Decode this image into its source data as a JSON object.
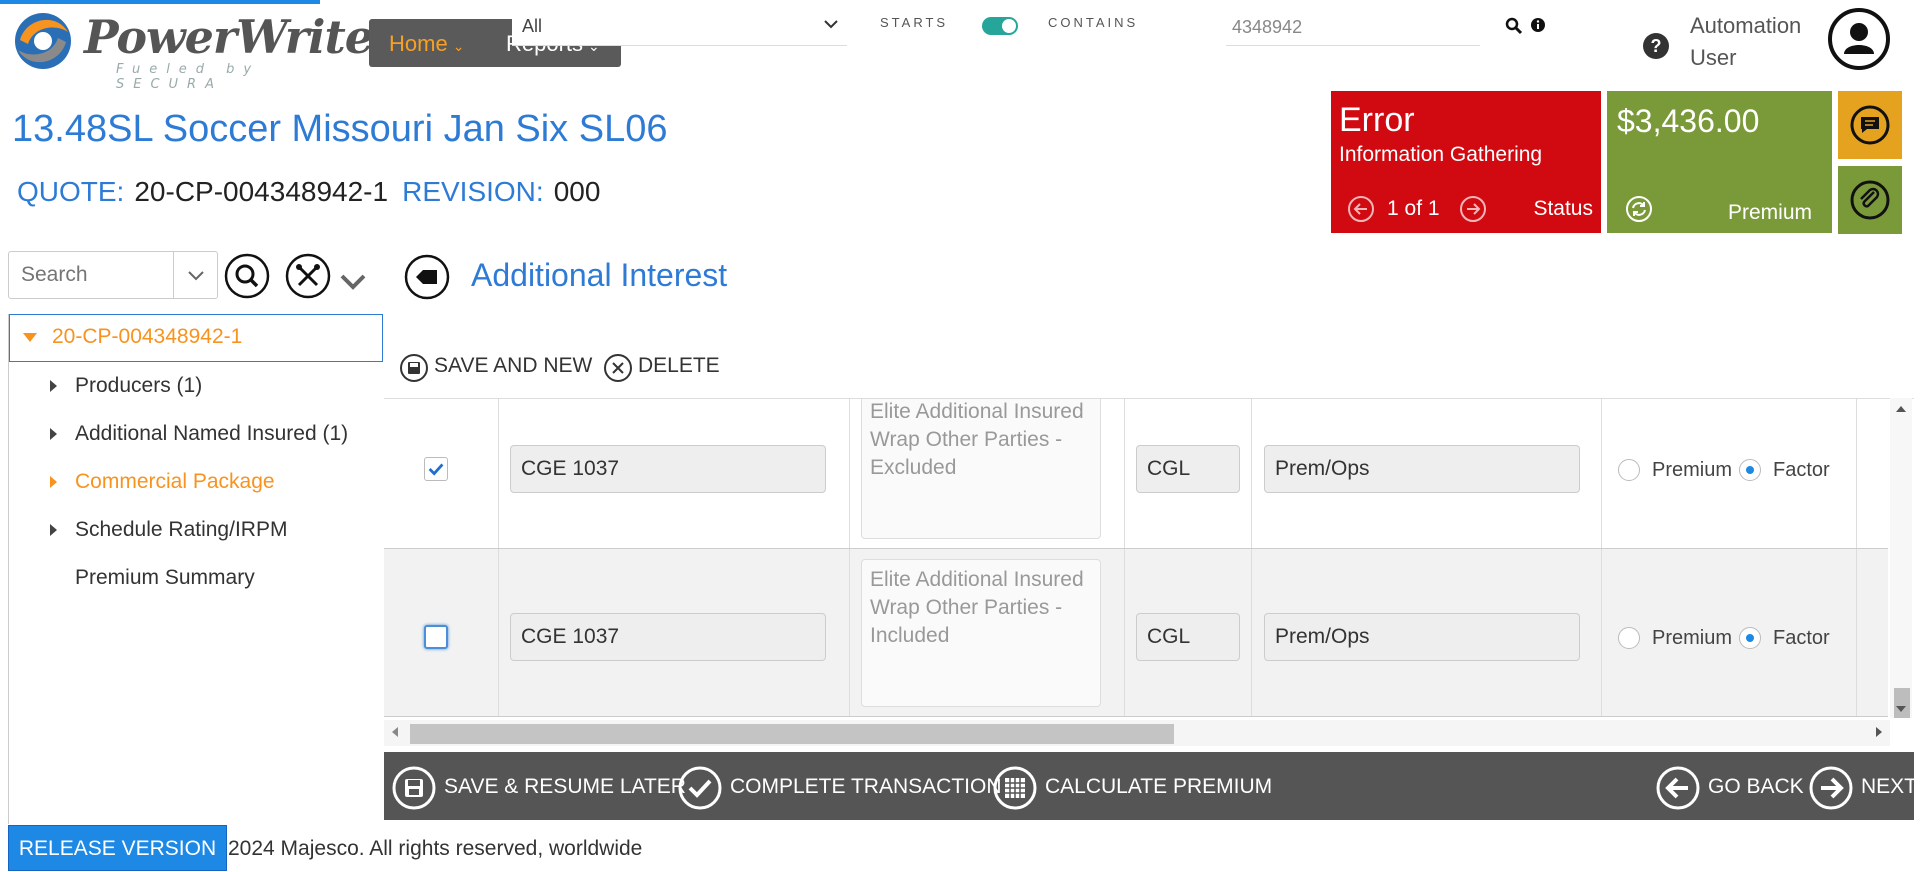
{
  "app": {
    "logo_name": "PowerWriter",
    "logo_tagline": "Fueled by SECURA"
  },
  "nav": {
    "home": "Home",
    "reports": "Reports"
  },
  "search_bar": {
    "scope_value": "All",
    "starts_label": "STARTS",
    "contains_label": "CONTAINS",
    "toggle_on": true,
    "query_value": "4348942"
  },
  "user": {
    "name": "Automation User"
  },
  "header": {
    "title": "13.48SL Soccer Missouri Jan Six SL06",
    "quote_label": "QUOTE:",
    "quote_value": "20-CP-004348942-1",
    "revision_label": "REVISION:",
    "revision_value": "000"
  },
  "status_tile": {
    "state": "Error",
    "detail": "Information Gathering",
    "pager": "1 of 1",
    "label": "Status",
    "color": "#d10a11"
  },
  "premium_tile": {
    "amount": "$3,436.00",
    "label": "Premium",
    "color": "#7a9a3a"
  },
  "sidebar": {
    "search_placeholder": "Search",
    "root": "20-CP-004348942-1",
    "items": [
      {
        "label": "Producers (1)",
        "expandable": true,
        "active": false
      },
      {
        "label": "Additional Named Insured (1)",
        "expandable": true,
        "active": false
      },
      {
        "label": "Commercial Package",
        "expandable": true,
        "active": true
      },
      {
        "label": "Schedule Rating/IRPM",
        "expandable": true,
        "active": false
      },
      {
        "label": "Premium Summary",
        "expandable": false,
        "active": false
      }
    ]
  },
  "section": {
    "title": "Additional Interest",
    "save_and_new": "SAVE AND NEW",
    "delete": "DELETE"
  },
  "grid": {
    "rows": [
      {
        "checked": true,
        "form": "CGE 1037",
        "description": "Elite Additional Insured Wrap Other Parties - Excluded",
        "lob": "CGL",
        "coverage": "Prem/Ops",
        "premium_label": "Premium",
        "factor_label": "Factor",
        "selected": "Factor"
      },
      {
        "checked": false,
        "form": "CGE 1037",
        "description": "Elite Additional Insured Wrap Other Parties - Included",
        "lob": "CGL",
        "coverage": "Prem/Ops",
        "premium_label": "Premium",
        "factor_label": "Factor",
        "selected": "Factor"
      }
    ]
  },
  "action_bar": {
    "save_resume": "SAVE & RESUME LATER",
    "complete": "COMPLETE TRANSACTION",
    "calculate": "CALCULATE PREMIUM",
    "go_back": "GO BACK",
    "next": "NEXT"
  },
  "footer": {
    "release": "RELEASE VERSION",
    "copyright": "2024 Majesco. All rights reserved, worldwide"
  }
}
